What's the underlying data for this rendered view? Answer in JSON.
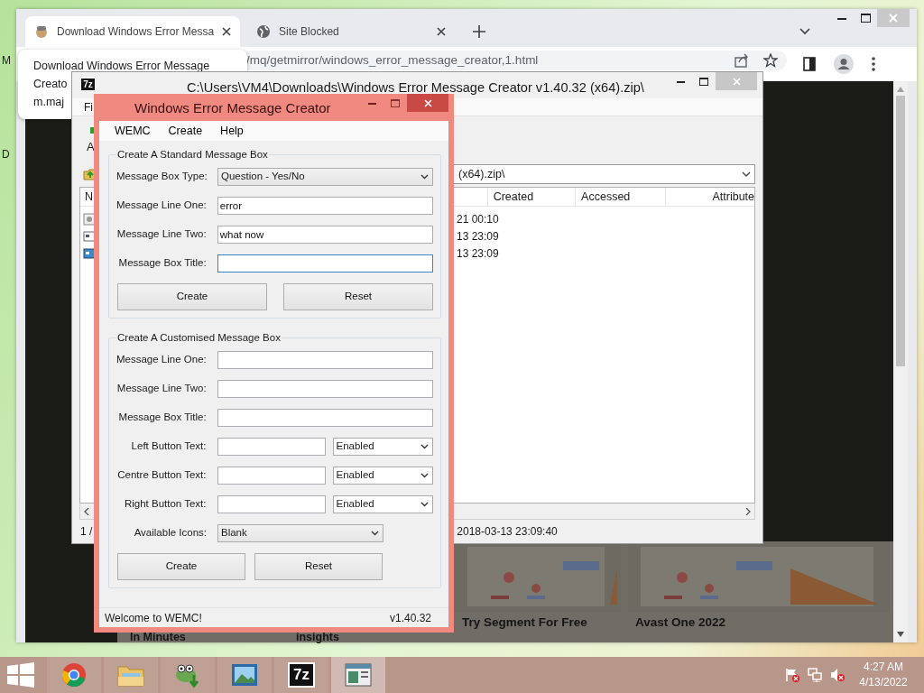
{
  "desktop": {
    "icon_labels": [
      "M",
      "D"
    ]
  },
  "browser": {
    "tabs": [
      {
        "title": "Download Windows Error Messa",
        "selected": true
      },
      {
        "title": "Site Blocked",
        "selected": false
      }
    ],
    "address": "/mq/getmirror/windows_error_message_creator,1.html",
    "tooltip": [
      "Download Windows Error Message",
      "Creato",
      "m.maj"
    ],
    "ads": [
      {
        "kind": "text",
        "caption": "In Minutes"
      },
      {
        "kind": "text",
        "caption": "insights"
      },
      {
        "kind": "picture",
        "caption": "Try Segment For Free"
      },
      {
        "kind": "picture",
        "caption": "Avast One 2022"
      }
    ]
  },
  "archive_window": {
    "icon": "7z",
    "title": "C:\\Users\\VM4\\Downloads\\Windows Error Message Creator v1.40.32 (x64).zip\\",
    "menu": "Fi",
    "toolbar": "A",
    "path": "(x64).zip\\",
    "columns": [
      "N",
      "Created",
      "Accessed",
      "Attribute"
    ],
    "rows": [
      "21 00:10",
      "13 23:09",
      "13 23:09"
    ],
    "status": [
      "1 /",
      "2018-03-13 23:09:40"
    ]
  },
  "wemc": {
    "title": "Windows Error Message Creator",
    "menu": [
      "WEMC",
      "Create",
      "Help"
    ],
    "standard": {
      "legend": "Create A Standard Message Box",
      "type": {
        "label": "Message Box Type:",
        "value": "Question - Yes/No"
      },
      "fields": [
        {
          "label": "Message Line One:",
          "value": "error",
          "focused": false
        },
        {
          "label": "Message Line Two:",
          "value": "what now",
          "focused": false
        },
        {
          "label": "Message Box Title:",
          "focused": true
        }
      ],
      "buttons": [
        "Create",
        "Reset"
      ]
    },
    "custom": {
      "legend": "Create A Customised Message Box",
      "rows": [
        {
          "kind": "text",
          "label": "Message Line One:"
        },
        {
          "kind": "text",
          "label": "Message Line Two:"
        },
        {
          "kind": "text",
          "label": "Message Box Title:"
        },
        {
          "kind": "text_state",
          "label": "Left Button Text:",
          "state": "Enabled"
        },
        {
          "kind": "text_state",
          "label": "Centre Button Text:",
          "state": "Enabled"
        },
        {
          "kind": "text_state",
          "label": "Right Button Text:",
          "state": "Enabled"
        },
        {
          "kind": "select",
          "label": "Available Icons:",
          "value": "Blank"
        }
      ],
      "buttons": [
        "Create",
        "Reset"
      ]
    },
    "status": [
      "Welcome to WEMC!",
      "v1.40.32"
    ]
  },
  "taskbar": {
    "apps": [
      {
        "kind": "chrome",
        "selected": false
      },
      {
        "kind": "explorer",
        "selected": false
      },
      {
        "kind": "frog",
        "selected": false
      },
      {
        "kind": "photos",
        "selected": false
      },
      {
        "kind": "sevenzip",
        "label": "7z",
        "selected": false
      },
      {
        "kind": "wemc",
        "selected": true
      }
    ],
    "time": "4:27 AM",
    "date": "4/13/2022"
  }
}
